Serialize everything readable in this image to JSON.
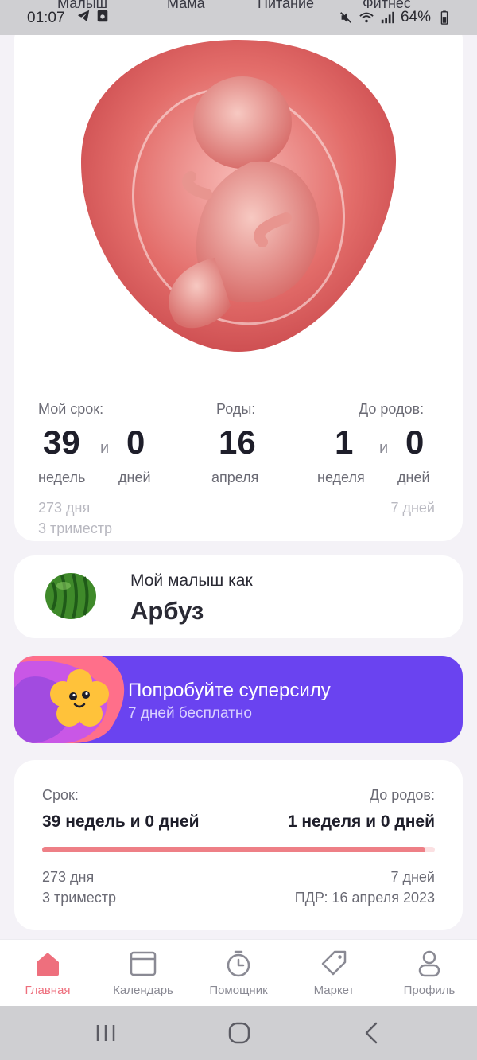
{
  "status_bar": {
    "time": "01:07",
    "battery": "64%"
  },
  "top_tabs": [
    "Малыш",
    "Мама",
    "Питание",
    "Фитнес"
  ],
  "hero": {
    "my_term_label": "Мой срок:",
    "weeks_value": "39",
    "and_word": "и",
    "days_value": "0",
    "weeks_unit": "недель",
    "days_unit": "дней",
    "birth_label": "Роды:",
    "birth_day": "16",
    "birth_month": "апреля",
    "until_label": "До родов:",
    "until_weeks": "1",
    "until_days": "0",
    "until_weeks_unit": "неделя",
    "until_days_unit": "дней",
    "total_days": "273 дня",
    "trimester": "3 триместр",
    "remaining_days": "7 дней"
  },
  "baby_size": {
    "label": "Мой малыш как",
    "fruit": "Арбуз"
  },
  "promo": {
    "title": "Попробуйте суперсилу",
    "subtitle": "7 дней бесплатно"
  },
  "progress": {
    "term_label": "Срок:",
    "term_value": "39 недель и 0 дней",
    "until_label": "До родов:",
    "until_value": "1 неделя и 0 дней",
    "fraction": 0.975,
    "days": "273 дня",
    "trimester": "3 триместр",
    "remaining": "7 дней",
    "due_date": "ПДР: 16 апреля 2023"
  },
  "bottom_nav": {
    "items": [
      {
        "label": "Главная",
        "icon": "home-icon",
        "active": true
      },
      {
        "label": "Календарь",
        "icon": "calendar-icon",
        "active": false
      },
      {
        "label": "Помощник",
        "icon": "timer-icon",
        "active": false
      },
      {
        "label": "Маркет",
        "icon": "tag-icon",
        "active": false
      },
      {
        "label": "Профиль",
        "icon": "profile-icon",
        "active": false
      }
    ]
  },
  "colors": {
    "accent": "#ee6f7d",
    "progress": "#ee7f86",
    "promo_bg": "#6a43f0"
  }
}
